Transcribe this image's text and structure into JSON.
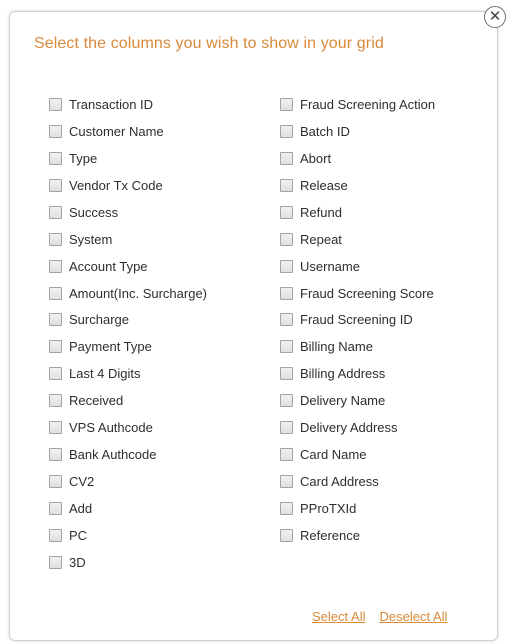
{
  "dialog": {
    "title": "Select the columns you wish to show in your grid",
    "close_label": "✕"
  },
  "columns_left": [
    {
      "label": "Transaction ID",
      "checked": false
    },
    {
      "label": "Customer Name",
      "checked": false
    },
    {
      "label": "Type",
      "checked": false
    },
    {
      "label": "Vendor Tx Code",
      "checked": false
    },
    {
      "label": "Success",
      "checked": false
    },
    {
      "label": "System",
      "checked": false
    },
    {
      "label": "Account Type",
      "checked": false
    },
    {
      "label": "Amount(Inc. Surcharge)",
      "checked": false
    },
    {
      "label": "Surcharge",
      "checked": false
    },
    {
      "label": "Payment Type",
      "checked": false
    },
    {
      "label": "Last 4 Digits",
      "checked": false
    },
    {
      "label": "Received",
      "checked": false
    },
    {
      "label": "VPS Authcode",
      "checked": false
    },
    {
      "label": "Bank Authcode",
      "checked": false
    },
    {
      "label": "CV2",
      "checked": false
    },
    {
      "label": "Add",
      "checked": false
    },
    {
      "label": "PC",
      "checked": false
    },
    {
      "label": "3D",
      "checked": false
    }
  ],
  "columns_right": [
    {
      "label": "Fraud Screening Action",
      "checked": false
    },
    {
      "label": "Batch ID",
      "checked": false
    },
    {
      "label": "Abort",
      "checked": false
    },
    {
      "label": "Release",
      "checked": false
    },
    {
      "label": "Refund",
      "checked": false
    },
    {
      "label": "Repeat",
      "checked": false
    },
    {
      "label": "Username",
      "checked": false
    },
    {
      "label": "Fraud Screening Score",
      "checked": false
    },
    {
      "label": "Fraud Screening ID",
      "checked": false
    },
    {
      "label": "Billing Name",
      "checked": false
    },
    {
      "label": "Billing Address",
      "checked": false
    },
    {
      "label": "Delivery Name",
      "checked": false
    },
    {
      "label": "Delivery Address",
      "checked": false
    },
    {
      "label": "Card Name",
      "checked": false
    },
    {
      "label": "Card Address",
      "checked": false
    },
    {
      "label": "PProTXId",
      "checked": false
    },
    {
      "label": "Reference",
      "checked": false
    }
  ],
  "actions": {
    "select_all": "Select All",
    "deselect_all": "Deselect All"
  },
  "colors": {
    "accent": "#d98a3a",
    "text": "#2e2e2e",
    "checkbox_border": "#a3a3a3"
  }
}
